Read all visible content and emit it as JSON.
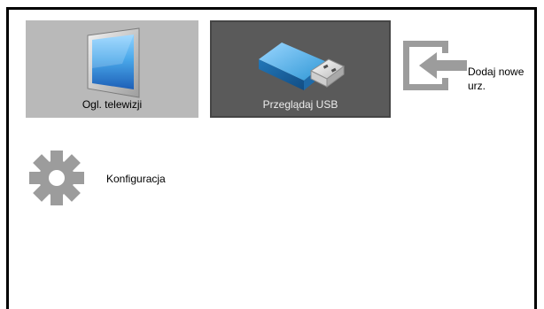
{
  "home_menu": {
    "watch_tv_label": "Ogl. telewizji",
    "browse_usb_label": "Przeglądaj USB",
    "add_device_line1": "Dodaj nowe",
    "add_device_line2": "urz.",
    "setup_label": "Konfiguracja",
    "selected_item": "Przeglądaj USB"
  },
  "icons": {
    "watch_tv": "tv-icon",
    "browse_usb": "usb-drive-icon",
    "add_device": "add-device-icon",
    "setup": "gear-icon"
  },
  "colors": {
    "tile_background": "#b9b9b9",
    "selected_tile_background": "#5a5a5a",
    "usb_blue": "#2f97d5",
    "icon_gray": "#9c9c9c"
  }
}
